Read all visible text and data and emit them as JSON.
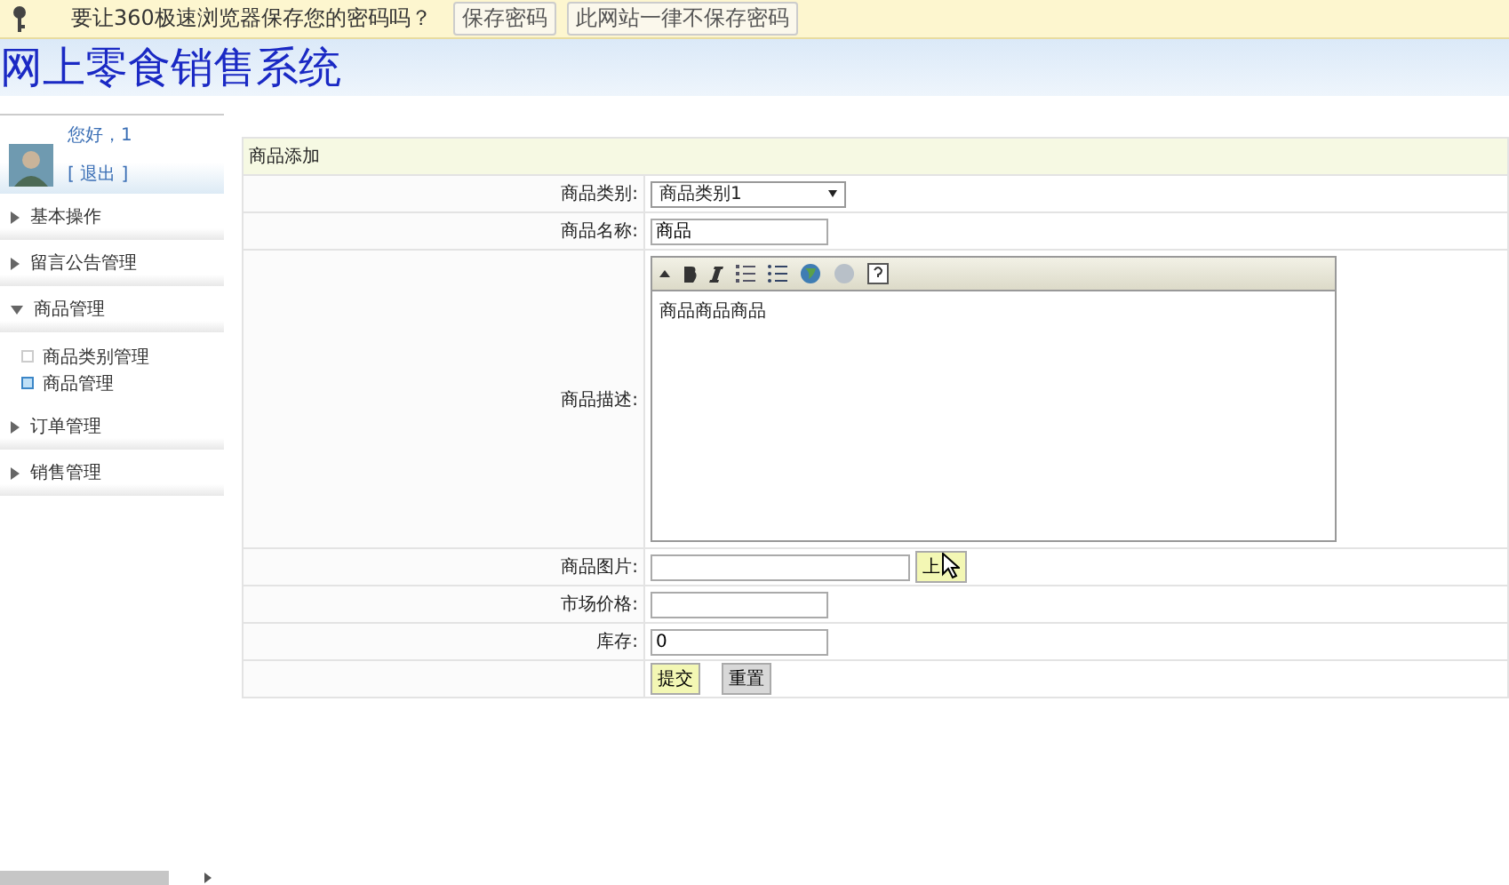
{
  "password_bar": {
    "message": "要让360极速浏览器保存您的密码吗？",
    "buttons": [
      "保存密码",
      "此网站一律不保存密码"
    ]
  },
  "header": {
    "title": "网上零食销售系统"
  },
  "user": {
    "greeting": "您好，1",
    "logout": "[  退出  ]"
  },
  "sidebar": {
    "items": [
      {
        "label": "基本操作",
        "expanded": false
      },
      {
        "label": "留言公告管理",
        "expanded": false
      },
      {
        "label": "商品管理",
        "expanded": true,
        "children": [
          {
            "label": "商品类别管理",
            "selected": false
          },
          {
            "label": "商品管理",
            "selected": true
          }
        ]
      },
      {
        "label": "订单管理",
        "expanded": false
      },
      {
        "label": "销售管理",
        "expanded": false
      }
    ]
  },
  "form": {
    "title": "商品添加",
    "rows": [
      {
        "kind": "select",
        "label": "商品类别:",
        "value": "商品类别1"
      },
      {
        "kind": "text",
        "label": "商品名称:",
        "value": "商品"
      },
      {
        "kind": "editor",
        "label": "商品描述:",
        "value": "商品商品商品"
      },
      {
        "kind": "upload",
        "label": "商品图片:",
        "value": "",
        "button": "上"
      },
      {
        "kind": "text",
        "label": "市场价格:",
        "value": ""
      },
      {
        "kind": "text",
        "label": "库存:",
        "value": "0"
      },
      {
        "kind": "actions",
        "buttons": [
          "提交",
          "重置"
        ]
      }
    ]
  }
}
